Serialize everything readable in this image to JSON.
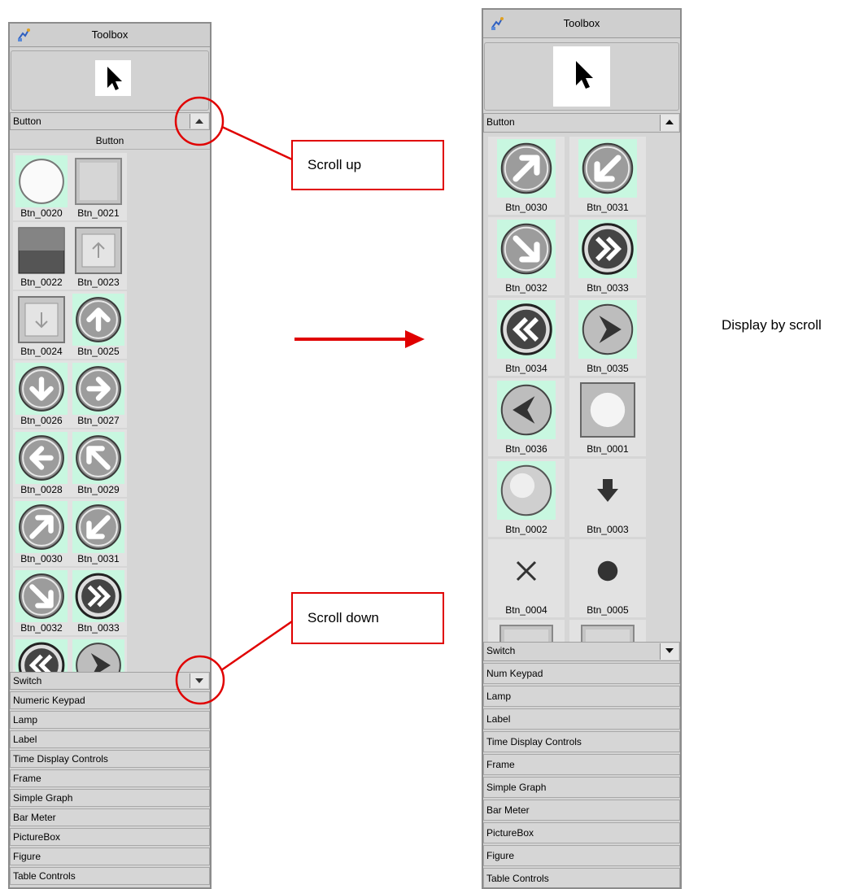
{
  "left_panel": {
    "title": "Toolbox",
    "category": "Button",
    "sub_header": "Button",
    "buttons": [
      {
        "label": "Btn_0020",
        "icon": "white-circle-icon",
        "bg": "#c8f7e0"
      },
      {
        "label": "Btn_0021",
        "icon": "grey-square-icon",
        "bg": "#e2e2e2"
      },
      {
        "label": "Btn_0022",
        "icon": "gradient-square-icon",
        "bg": "#e2e2e2"
      },
      {
        "label": "Btn_0023",
        "icon": "up-arrow-square-icon",
        "bg": "#e2e2e2"
      },
      {
        "label": "Btn_0024",
        "icon": "down-arrow-square-icon",
        "bg": "#e2e2e2"
      },
      {
        "label": "Btn_0025",
        "icon": "arrow-up-circle-icon",
        "bg": "#c8f7e0"
      },
      {
        "label": "Btn_0026",
        "icon": "arrow-down-circle-icon",
        "bg": "#c8f7e0"
      },
      {
        "label": "Btn_0027",
        "icon": "arrow-right-circle-icon",
        "bg": "#c8f7e0"
      },
      {
        "label": "Btn_0028",
        "icon": "arrow-left-circle-icon",
        "bg": "#c8f7e0"
      },
      {
        "label": "Btn_0029",
        "icon": "arrow-up-left-circle-icon",
        "bg": "#c8f7e0"
      },
      {
        "label": "Btn_0030",
        "icon": "arrow-up-right-circle-icon",
        "bg": "#c8f7e0"
      },
      {
        "label": "Btn_0031",
        "icon": "arrow-down-left-circle-icon",
        "bg": "#c8f7e0"
      },
      {
        "label": "Btn_0032",
        "icon": "arrow-down-right-circle-icon",
        "bg": "#c8f7e0"
      },
      {
        "label": "Btn_0033",
        "icon": "double-chevron-right-circle-icon",
        "bg": "#c8f7e0"
      },
      {
        "label": "",
        "icon": "double-chevron-left-circle-icon",
        "bg": "#c8f7e0"
      },
      {
        "label": "",
        "icon": "play-right-circle-icon",
        "bg": "#c8f7e0"
      }
    ],
    "next_category": "Switch",
    "categories": [
      "Numeric Keypad",
      "Lamp",
      "Label",
      "Time Display Controls",
      "Frame",
      "Simple Graph",
      "Bar Meter",
      "PictureBox",
      "Figure",
      "Table Controls"
    ]
  },
  "right_panel": {
    "title": "Toolbox",
    "category": "Button",
    "buttons": [
      {
        "label": "Btn_0030",
        "icon": "arrow-up-right-circle-icon",
        "bg": "#c8f7e0"
      },
      {
        "label": "Btn_0031",
        "icon": "arrow-down-left-circle-icon",
        "bg": "#c8f7e0"
      },
      {
        "label": "Btn_0032",
        "icon": "arrow-down-right-circle-icon",
        "bg": "#c8f7e0"
      },
      {
        "label": "Btn_0033",
        "icon": "double-chevron-right-circle-icon",
        "bg": "#c8f7e0"
      },
      {
        "label": "Btn_0034",
        "icon": "double-chevron-left-circle-icon",
        "bg": "#c8f7e0"
      },
      {
        "label": "Btn_0035",
        "icon": "play-right-circle-icon",
        "bg": "#c8f7e0"
      },
      {
        "label": "Btn_0036",
        "icon": "play-left-circle-icon",
        "bg": "#c8f7e0"
      },
      {
        "label": "Btn_0001",
        "icon": "glow-square-icon",
        "bg": "#e2e2e2"
      },
      {
        "label": "Btn_0002",
        "icon": "plain-circle-icon",
        "bg": "#c8f7e0"
      },
      {
        "label": "Btn_0003",
        "icon": "down-arrow-icon",
        "bg": "#e2e2e2"
      },
      {
        "label": "Btn_0004",
        "icon": "cross-icon",
        "bg": "#e2e2e2"
      },
      {
        "label": "Btn_0005",
        "icon": "dot-icon",
        "bg": "#e2e2e2"
      },
      {
        "label": "",
        "icon": "grey-square-icon",
        "bg": "#e2e2e2"
      },
      {
        "label": "",
        "icon": "grey-square-icon",
        "bg": "#e2e2e2"
      }
    ],
    "next_category": "Switch",
    "categories": [
      "Num Keypad",
      "Lamp",
      "Label",
      "Time Display Controls",
      "Frame",
      "Simple Graph",
      "Bar Meter",
      "PictureBox",
      "Figure",
      "Table Controls"
    ]
  },
  "annotations": {
    "scroll_up": "Scroll up",
    "scroll_down": "Scroll down",
    "display_by_scroll": "Display by scroll"
  },
  "colors": {
    "callout": "#e00000",
    "icon_bg": "#c8f7e0"
  }
}
